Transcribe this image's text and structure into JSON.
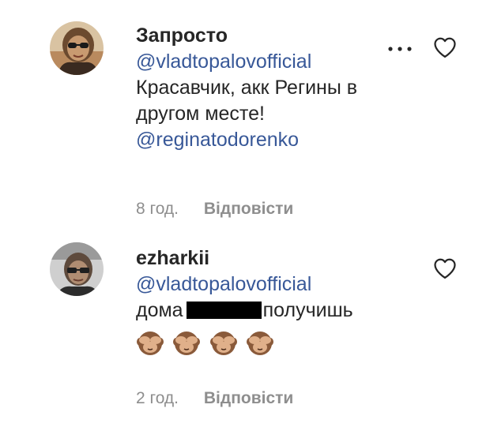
{
  "comments": [
    {
      "username": "Запросто",
      "text_lines": [
        "@vladtopalovofficial",
        "Красавчик, акк Регины в",
        "другом месте!",
        "@reginatodorenko"
      ],
      "time": "8 год.",
      "reply_label": "Відповісти",
      "has_more_icon": true
    },
    {
      "username": "ezharkii",
      "mention": "@vladtopalovofficial",
      "text_before_redaction": "дома",
      "text_after_redaction": "получишь",
      "emoji": [
        "see-no-evil-monkey",
        "see-no-evil-monkey",
        "see-no-evil-monkey",
        "see-no-evil-monkey"
      ],
      "time": "2 год.",
      "reply_label": "Відповісти"
    }
  ],
  "colors": {
    "text": "#262626",
    "mention": "#385898",
    "meta": "#8e8e8e",
    "redaction": "#000000"
  },
  "icons": {
    "more": "more-horizontal-icon",
    "like": "heart-outline-icon"
  }
}
